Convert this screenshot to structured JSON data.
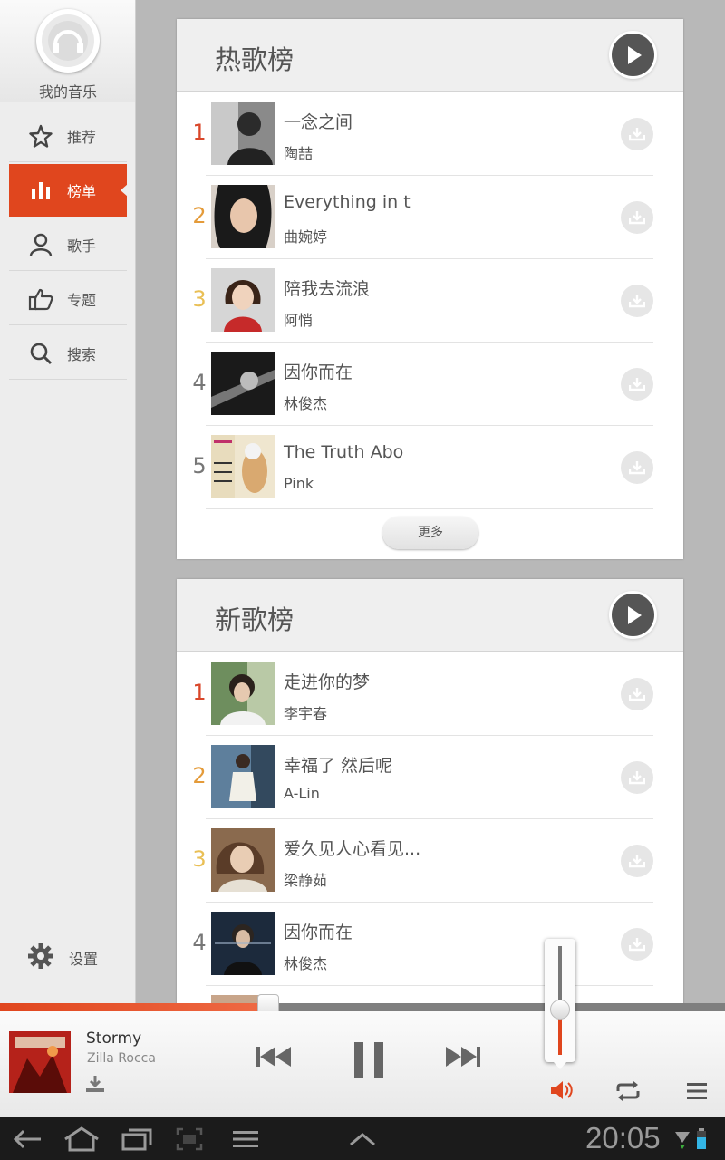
{
  "sidebar": {
    "profile_label": "我的音乐",
    "items": [
      {
        "label": "推荐",
        "icon": "star-icon"
      },
      {
        "label": "榜单",
        "icon": "chart-bars-icon",
        "active": true
      },
      {
        "label": "歌手",
        "icon": "person-icon"
      },
      {
        "label": "专题",
        "icon": "thumbs-up-icon"
      },
      {
        "label": "搜索",
        "icon": "search-icon"
      }
    ],
    "settings_label": "设置"
  },
  "hot_chart": {
    "title": "热歌榜",
    "rows": [
      {
        "rank": "1",
        "song": "一念之间",
        "artist": "陶喆"
      },
      {
        "rank": "2",
        "song": "Everything in t",
        "artist": "曲婉婷"
      },
      {
        "rank": "3",
        "song": "陪我去流浪",
        "artist": "阿悄"
      },
      {
        "rank": "4",
        "song": "因你而在",
        "artist": "林俊杰"
      },
      {
        "rank": "5",
        "song": "The Truth Abo",
        "artist": "Pink"
      }
    ],
    "more_label": "更多"
  },
  "new_chart": {
    "title": "新歌榜",
    "rows": [
      {
        "rank": "1",
        "song": "走进你的梦",
        "artist": "李宇春"
      },
      {
        "rank": "2",
        "song": "幸福了 然后呢",
        "artist": "A-Lin"
      },
      {
        "rank": "3",
        "song": "爱久见人心看见...",
        "artist": "梁静茹"
      },
      {
        "rank": "4",
        "song": "因你而在",
        "artist": "林俊杰"
      }
    ]
  },
  "player": {
    "title": "Stormy",
    "artist": "Zilla Rocca",
    "progress": 0.37,
    "volume": 0.42,
    "accent_color": "#e0461e"
  },
  "system_bar": {
    "clock": "20:05"
  }
}
